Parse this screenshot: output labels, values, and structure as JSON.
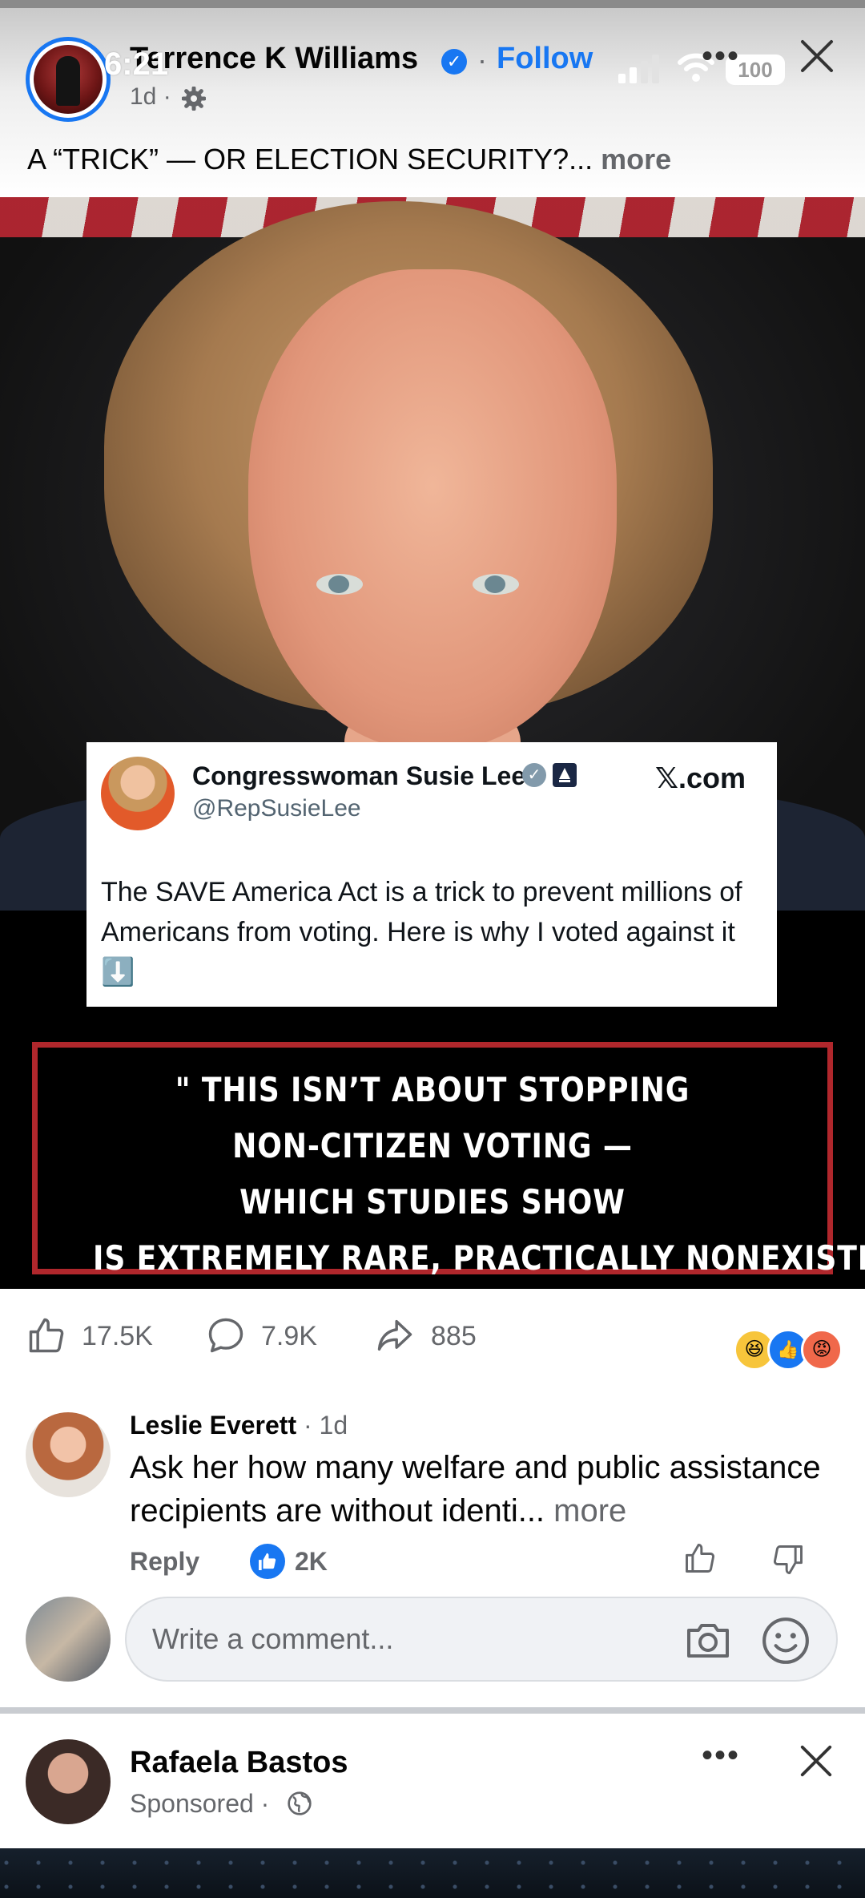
{
  "status_bar": {
    "time": "6:21",
    "battery": "100"
  },
  "post": {
    "author": "Terrence K Williams",
    "follow_label": "Follow",
    "separator": "·",
    "age": "1d ·",
    "caption": "A “TRICK” — OR ELECTION SECURITY?...",
    "caption_more": " more"
  },
  "tweet": {
    "name": "Congresswoman Susie Lee",
    "handle": "@RepSusieLee",
    "source": "𝕏.com",
    "body": "The SAVE America Act is a trick to prevent millions of Americans from voting. Here is why I voted against it ⬇️"
  },
  "quote": {
    "lines": [
      "\" THIS ISN’T ABOUT STOPPING",
      "NON-CITIZEN VOTING —",
      "WHICH STUDIES SHOW",
      "IS EXTREMELY RARE, PRACTICALLY NONEXISTENT\""
    ]
  },
  "engagement": {
    "likes": "17.5K",
    "comments": "7.9K",
    "shares": "885",
    "reaction_emojis": [
      "haha-icon",
      "like-icon",
      "angry-icon"
    ]
  },
  "comment": {
    "author": "Leslie Everett",
    "time": " · 1d",
    "text": "Ask her how many welfare and public assistance recipients are without identi...",
    "more": " more",
    "reply_label": "Reply",
    "like_count": "2K"
  },
  "composer": {
    "placeholder": "Write a comment..."
  },
  "next_post": {
    "author": "Rafaela Bastos",
    "sponsored": "Sponsored ·"
  },
  "colors": {
    "accent": "#1877f2",
    "quote_border": "#b0272c",
    "muted": "#65676b"
  }
}
